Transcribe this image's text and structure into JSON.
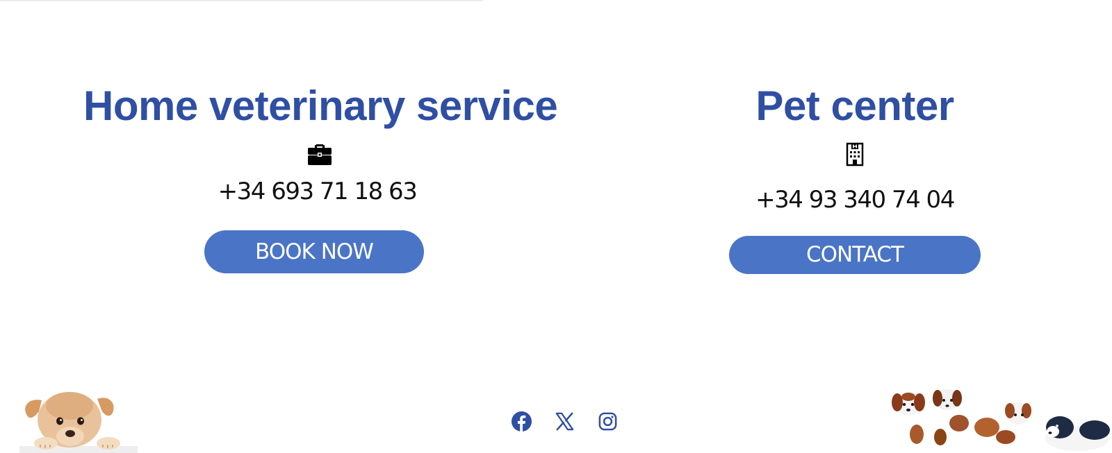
{
  "home_service": {
    "title": "Home veterinary service",
    "icon": "briefcase-icon",
    "phone": "+34 693 71 18 63",
    "button_label": "BOOK NOW"
  },
  "pet_center": {
    "title": "Pet center",
    "icon": "hospital-building-icon",
    "phone": "+34 93 340 74 04",
    "button_label": "CONTACT"
  },
  "social": {
    "items": [
      "facebook-icon",
      "x-icon",
      "instagram-icon"
    ],
    "color": "#2f4fa4"
  },
  "colors": {
    "title": "#2f4fa4",
    "button": "#4a74c6",
    "button_text": "#ffffff",
    "phone_text": "#111111",
    "background": "#ffffff"
  },
  "images": {
    "left": "puppy-peeking-image",
    "right": "puppies-group-image"
  }
}
